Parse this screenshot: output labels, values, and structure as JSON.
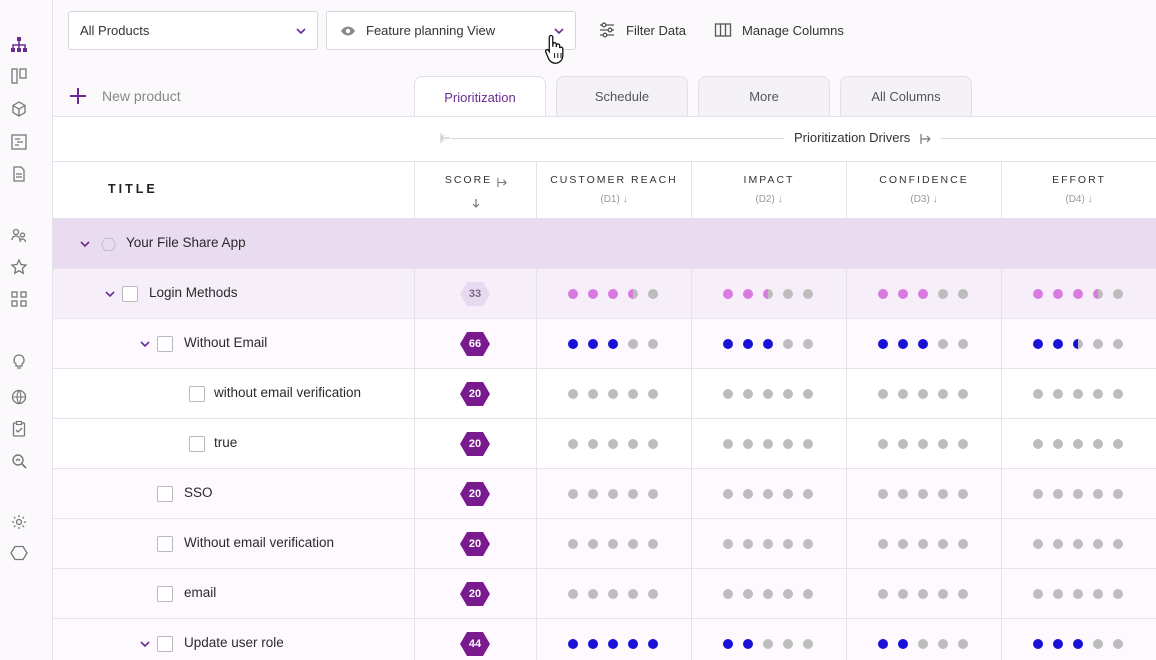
{
  "toolbar": {
    "product_select": "All Products",
    "view_select": "Feature planning View",
    "filter_label": "Filter Data",
    "columns_label": "Manage Columns"
  },
  "new_product_label": "New product",
  "tabs": [
    "Prioritization",
    "Schedule",
    "More",
    "All Columns"
  ],
  "drivers_label": "Prioritization Drivers",
  "columns": {
    "title": "TITLE",
    "score": "SCORE",
    "reach": {
      "label": "CUSTOMER REACH",
      "sub": "(D1)"
    },
    "impact": {
      "label": "IMPACT",
      "sub": "(D2)"
    },
    "confidence": {
      "label": "CONFIDENCE",
      "sub": "(D3)"
    },
    "effort": {
      "label": "EFFORT",
      "sub": "(D4)"
    }
  },
  "colors": {
    "accent": "#6a2c91",
    "badge": "#7a1a8f",
    "dot_blue": "#1a10d6",
    "dot_pink": "#d97ae0",
    "dot_gray": "#bdbdbd",
    "group_row": "#e9dcf0",
    "sub_row": "#f6eef9"
  },
  "rows": [
    {
      "title": "Your File Share App",
      "kind": "group",
      "level": 0
    },
    {
      "title": "Login Methods",
      "kind": "sub",
      "level": 1,
      "score": "33",
      "badge": "light",
      "dot_color": "pink",
      "reach": 3.5,
      "impact": 2.5,
      "confidence": 3,
      "effort": 3.5
    },
    {
      "title": "Without Email",
      "kind": "item",
      "level": 2,
      "score": "66",
      "badge": "dark",
      "dot_color": "blue",
      "reach": 3,
      "impact": 3,
      "confidence": 3,
      "effort": 2.5
    },
    {
      "title": "without email verification",
      "kind": "leaf",
      "level": 3,
      "score": "20",
      "badge": "dark",
      "dot_color": "gray",
      "reach": 0,
      "impact": 0,
      "confidence": 0,
      "effort": 0
    },
    {
      "title": "true",
      "kind": "leaf",
      "level": 3,
      "score": "20",
      "badge": "dark",
      "dot_color": "gray",
      "reach": 0,
      "impact": 0,
      "confidence": 0,
      "effort": 0
    },
    {
      "title": "SSO",
      "kind": "item",
      "level": 2,
      "score": "20",
      "badge": "dark",
      "dot_color": "gray",
      "reach": 0,
      "impact": 0,
      "confidence": 0,
      "effort": 0
    },
    {
      "title": "Without email verification",
      "kind": "item",
      "level": 2,
      "score": "20",
      "badge": "dark",
      "dot_color": "gray",
      "reach": 0,
      "impact": 0,
      "confidence": 0,
      "effort": 0
    },
    {
      "title": "email",
      "kind": "item",
      "level": 2,
      "score": "20",
      "badge": "dark",
      "dot_color": "gray",
      "reach": 0,
      "impact": 0,
      "confidence": 0,
      "effort": 0
    },
    {
      "title": "Update user role",
      "kind": "item",
      "level": 2,
      "score": "44",
      "badge": "dark",
      "dot_color": "blue",
      "reach": 5,
      "impact": 2,
      "confidence": 2,
      "effort": 3
    }
  ]
}
